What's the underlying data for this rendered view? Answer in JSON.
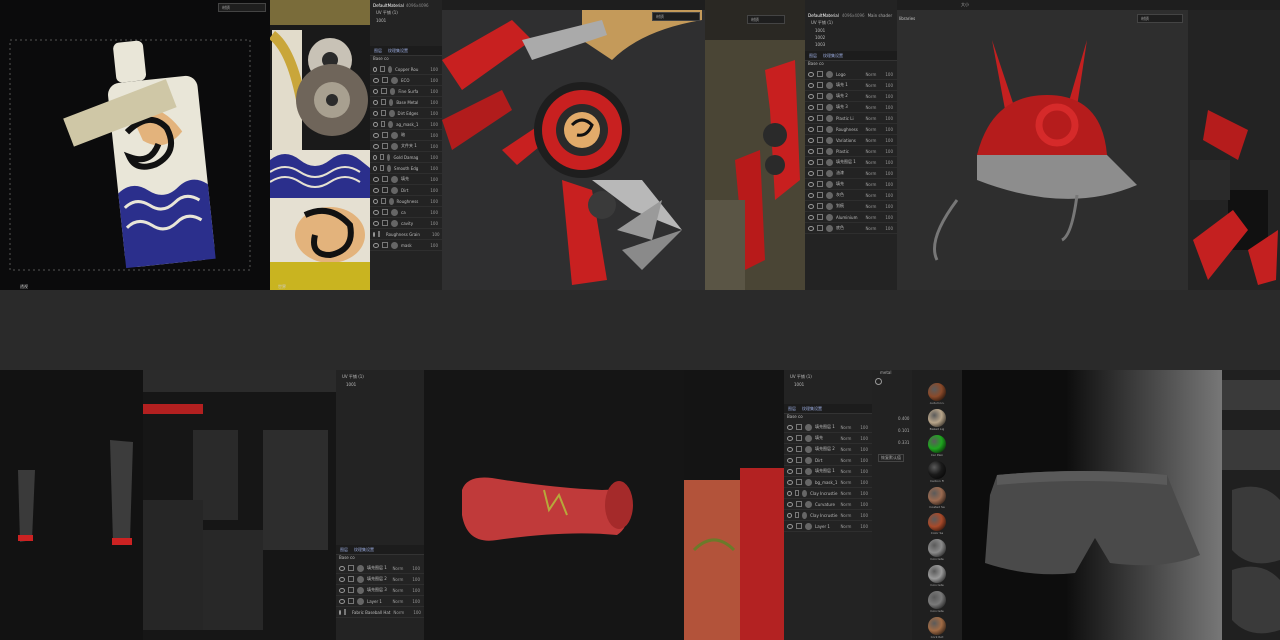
{
  "top": {
    "viewport1": {
      "select": "材质",
      "status": "透视"
    },
    "uv": {
      "label": "世界"
    },
    "panel_a": {
      "title": "DefaultMaterial",
      "res": "4096x4096",
      "uv_label": "UV 平铺 (1)",
      "tile": "1001",
      "tabs": [
        "图层",
        "纹理集设置"
      ],
      "mode": "Base co",
      "layers": [
        {
          "name": "Copper Rou",
          "val": "100"
        },
        {
          "name": "ECO",
          "val": "100"
        },
        {
          "name": "Fine Surfa",
          "val": "100"
        },
        {
          "name": "Base Metal",
          "val": "100"
        },
        {
          "name": "Dirt Edges",
          "val": "100"
        },
        {
          "name": "ag_mask_1",
          "val": "100"
        },
        {
          "name": "暗",
          "val": "100"
        },
        {
          "name": "文件夹 1",
          "val": "100"
        },
        {
          "name": "Gold Damag",
          "val": "100"
        },
        {
          "name": "Smooth Edg",
          "val": "100"
        },
        {
          "name": "填充",
          "val": "100"
        },
        {
          "name": "Dirt",
          "val": "100"
        },
        {
          "name": "Roughness",
          "val": "100"
        },
        {
          "name": "ca",
          "val": "100"
        },
        {
          "name": "cavity",
          "val": "100"
        },
        {
          "name": "Roughness Grain",
          "val": "100"
        },
        {
          "name": "mask",
          "val": "100"
        }
      ]
    },
    "viewport2": {
      "select": "材质"
    },
    "uv2": {
      "label": "材质"
    },
    "panel_b": {
      "title": "DefaultMaterial",
      "res": "4096x4096",
      "shader": "Main shader",
      "uv_label": "UV 平铺 (1)",
      "tiles": [
        "1001",
        "1002",
        "1003"
      ],
      "tabs": [
        "图层",
        "纹理集设置"
      ],
      "mode": "Base co",
      "layers": [
        {
          "name": "Logo",
          "blend": "Norm",
          "val": "100"
        },
        {
          "name": "填充 1",
          "blend": "Norm",
          "val": "100"
        },
        {
          "name": "填充 2",
          "blend": "Norm",
          "val": "100"
        },
        {
          "name": "填充 3",
          "blend": "Norm",
          "val": "100"
        },
        {
          "name": "Plastic Li",
          "blend": "Norm",
          "val": "100"
        },
        {
          "name": "Roughness",
          "blend": "Norm",
          "val": "100"
        },
        {
          "name": "Variations",
          "blend": "Norm",
          "val": "100"
        },
        {
          "name": "Plastic",
          "blend": "Norm",
          "val": "100"
        },
        {
          "name": "填充图层 1",
          "blend": "Norm",
          "val": "100"
        },
        {
          "name": "油漆",
          "blend": "Norm",
          "val": "100"
        },
        {
          "name": "填充",
          "blend": "Norm",
          "val": "100"
        },
        {
          "name": "灰色",
          "blend": "Norm",
          "val": "100"
        },
        {
          "name": "划痕",
          "blend": "Norm",
          "val": "100"
        },
        {
          "name": "Aluminium",
          "blend": "Norm",
          "val": "100"
        },
        {
          "name": "底色",
          "blend": "Norm",
          "val": "100"
        }
      ]
    },
    "viewport3": {
      "size_label": "大小",
      "select": "材质",
      "zoom": "0.4000"
    },
    "lib_label": "libraries"
  },
  "bottom": {
    "panel_c": {
      "uv_label": "UV 平铺 (1)",
      "tile": "1001",
      "tabs": [
        "图层",
        "纹理集设置"
      ],
      "mode": "Base co",
      "layers": [
        {
          "name": "填充图层 1",
          "blend": "Norm",
          "val": "100"
        },
        {
          "name": "填充图层 2",
          "blend": "Norm",
          "val": "100"
        },
        {
          "name": "填充图层 3",
          "blend": "Norm",
          "val": "100"
        },
        {
          "name": "Layer 1",
          "blend": "Norm",
          "val": "100"
        },
        {
          "name": "Fabric Baseball Hat",
          "blend": "Norm",
          "val": "100"
        }
      ]
    },
    "panel_d": {
      "uv_label": "UV 平铺 (1)",
      "tile": "1001",
      "tabs": [
        "图层",
        "纹理集设置"
      ],
      "mode": "Base co",
      "layers": [
        {
          "name": "填充图层 1",
          "blend": "Norm",
          "val": "100"
        },
        {
          "name": "填充",
          "blend": "Norm",
          "val": "100"
        },
        {
          "name": "填充图层 2",
          "blend": "Norm",
          "val": "100"
        },
        {
          "name": "Dirt",
          "blend": "Norm",
          "val": "100"
        },
        {
          "name": "填充图层 1",
          "blend": "Norm",
          "val": "100"
        },
        {
          "name": "bg_mask_1",
          "blend": "Norm",
          "val": "100"
        },
        {
          "name": "Clay Incrustie",
          "blend": "Norm",
          "val": "100"
        },
        {
          "name": "Curvature",
          "blend": "Norm",
          "val": "100"
        },
        {
          "name": "Clay Incrustie",
          "blend": "Norm",
          "val": "100"
        },
        {
          "name": "Layer 1",
          "blend": "Norm",
          "val": "100"
        }
      ],
      "props": {
        "tag": "metal",
        "v1": "0.400",
        "v2": "0.101",
        "v3": "0.331",
        "button": "恢复默认值"
      }
    },
    "matlib": {
      "items": [
        {
          "name": "Autumn L",
          "color": "#8a4a2a"
        },
        {
          "name": "Baked Lig",
          "color": "#b8a58a"
        },
        {
          "name": "Car Pain",
          "color": "#1fa51f"
        },
        {
          "name": "Carbon Fi",
          "color": "#1a1a1a"
        },
        {
          "name": "Coated Sa",
          "color": "#9a6a50"
        },
        {
          "name": "Color Sa",
          "color": "#a84a2a"
        },
        {
          "name": "Concrete",
          "color": "#8a8a8a"
        },
        {
          "name": "Concrete",
          "color": "#9a9a9a"
        },
        {
          "name": "Concrete",
          "color": "#7a7a7a"
        },
        {
          "name": "Cork Rot",
          "color": "#a06b45"
        }
      ]
    }
  }
}
